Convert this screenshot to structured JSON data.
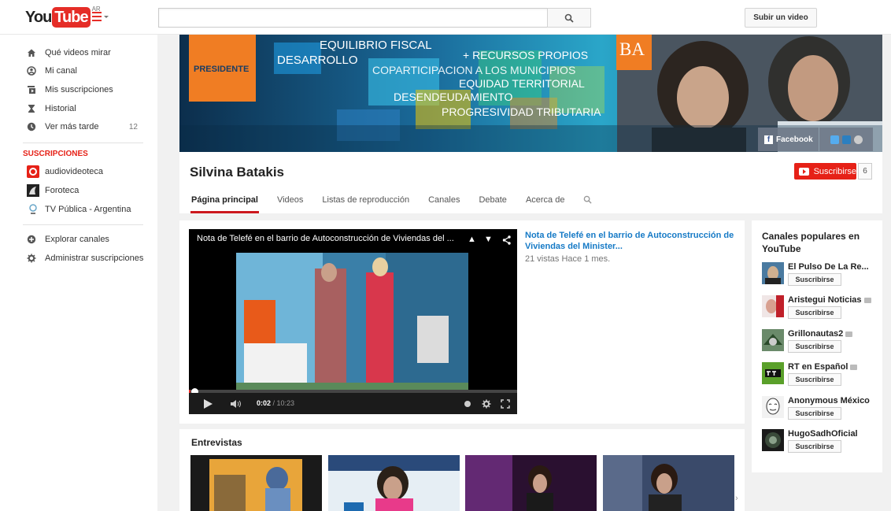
{
  "header": {
    "logo_you": "You",
    "logo_tube": "Tube",
    "country": "AR",
    "search_placeholder": "",
    "upload_label": "Subir un video"
  },
  "sidebar": {
    "items": [
      {
        "label": "Qué videos mirar",
        "icon": "home-icon"
      },
      {
        "label": "Mi canal",
        "icon": "user-icon"
      },
      {
        "label": "Mis suscripciones",
        "icon": "subscriptions-icon"
      },
      {
        "label": "Historial",
        "icon": "hourglass-icon"
      },
      {
        "label": "Ver más tarde",
        "icon": "clock-icon",
        "count": "12"
      }
    ],
    "subs_heading": "SUSCRIPCIONES",
    "subscriptions": [
      {
        "label": "audiovideoteca"
      },
      {
        "label": "Foroteca"
      },
      {
        "label": "TV Pública - Argentina"
      }
    ],
    "bottom": [
      {
        "label": "Explorar canales",
        "icon": "plus-circle-icon"
      },
      {
        "label": "Administrar suscripciones",
        "icon": "gear-icon"
      }
    ]
  },
  "banner": {
    "presidente": "PRESIDENTE",
    "ba": "BA",
    "lines": [
      "EQUILIBRIO FISCAL",
      "DESARROLLO",
      "+ RECURSOS PROPIOS",
      "COPARTICIPACION A LOS MUNICIPIOS",
      "EQUIDAD TERRITORIAL",
      "DESENDEUDAMIENTO",
      "PROGRESIVIDAD TRIBUTARIA"
    ],
    "facebook_label": "Facebook"
  },
  "channel": {
    "name": "Silvina Batakis",
    "subscribe_label": "Suscribirse",
    "subscriber_count": "6",
    "tabs": [
      "Página principal",
      "Videos",
      "Listas de reproducción",
      "Canales",
      "Debate",
      "Acerca de"
    ]
  },
  "featured": {
    "player_title": "Nota de Telefé en el barrio de Autoconstrucción de Viviendas del ...",
    "time_current": "0:02",
    "time_total": " / 10:23",
    "progress": 0.003,
    "title": "Nota de Telefé en el barrio de Autoconstrucción de Viviendas del Minister...",
    "meta": "21 vistas  Hace 1 mes."
  },
  "shelf": {
    "title": "Entrevistas"
  },
  "popular": {
    "title": "Canales populares en YouTube",
    "subscribe_label": "Suscribirse",
    "channels": [
      {
        "name": "El Pulso De La Re..."
      },
      {
        "name": "Aristegui Noticias"
      },
      {
        "name": "Grillonautas2"
      },
      {
        "name": "RT en Español"
      },
      {
        "name": "Anonymous México"
      },
      {
        "name": "HugoSadhOficial"
      }
    ]
  }
}
